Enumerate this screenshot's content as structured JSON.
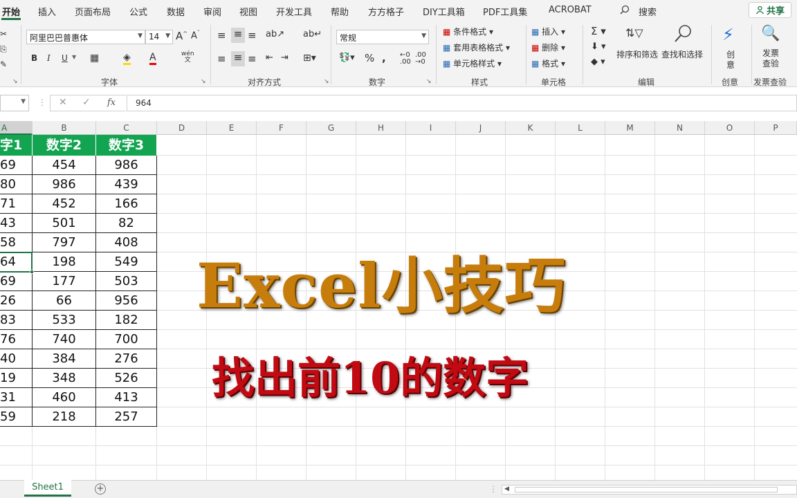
{
  "ribbon_tabs": [
    "开始",
    "插入",
    "页面布局",
    "公式",
    "数据",
    "审阅",
    "视图",
    "开发工具",
    "帮助",
    "方方格子",
    "DIY工具箱",
    "PDF工具集",
    "ACROBAT",
    "搜索"
  ],
  "share_label": "共享",
  "font": {
    "name": "阿里巴巴普惠体",
    "size": "14",
    "group_label": "字体"
  },
  "alignment": {
    "group_label": "对齐方式"
  },
  "number": {
    "format": "常规",
    "group_label": "数字"
  },
  "styles": {
    "conditional": "条件格式",
    "table": "套用表格格式",
    "cell": "单元格样式",
    "group_label": "样式"
  },
  "cells": {
    "insert": "插入",
    "delete": "删除",
    "format": "格式",
    "group_label": "单元格"
  },
  "editing": {
    "sort": "排序和筛选",
    "find": "查找和选择",
    "group_label": "编辑"
  },
  "create": {
    "label": "创\n意",
    "group_label": "创意"
  },
  "invoice": {
    "label": "发票查验",
    "group_label": "发票查验"
  },
  "formula_bar": {
    "value": "964"
  },
  "columns": [
    "A",
    "B",
    "C",
    "D",
    "E",
    "F",
    "G",
    "H",
    "I",
    "J",
    "K",
    "L",
    "M",
    "N",
    "O",
    "P"
  ],
  "selected_column": "A",
  "table": {
    "headers": [
      "字1",
      "数字2",
      "数字3"
    ],
    "rows": [
      [
        "69",
        "454",
        "986"
      ],
      [
        "80",
        "986",
        "439"
      ],
      [
        "71",
        "452",
        "166"
      ],
      [
        "43",
        "501",
        "82"
      ],
      [
        "58",
        "797",
        "408"
      ],
      [
        "64",
        "198",
        "549"
      ],
      [
        "69",
        "177",
        "503"
      ],
      [
        "26",
        "66",
        "956"
      ],
      [
        "83",
        "533",
        "182"
      ],
      [
        "76",
        "740",
        "700"
      ],
      [
        "40",
        "384",
        "276"
      ],
      [
        "19",
        "348",
        "526"
      ],
      [
        "31",
        "460",
        "413"
      ],
      [
        "59",
        "218",
        "257"
      ]
    ]
  },
  "overlay": {
    "title": "Excel小技巧",
    "subtitle": "找出前10的数字"
  },
  "sheet_tab": "Sheet1",
  "colors": {
    "accent": "#217346",
    "header_fill": "#13a451",
    "title": "#c77d0c",
    "subtitle": "#c10a12"
  }
}
